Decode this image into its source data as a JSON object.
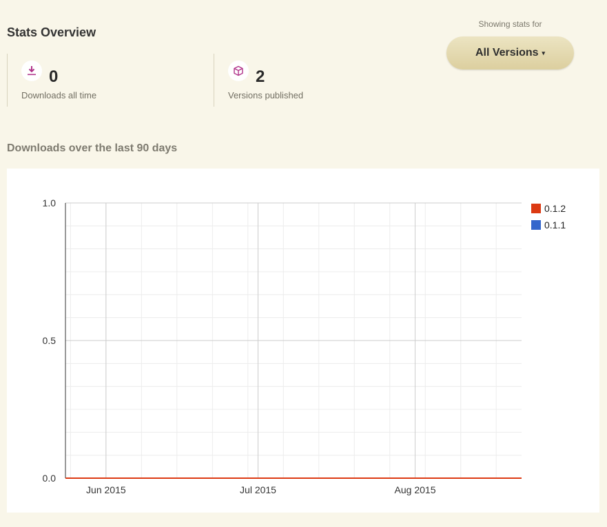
{
  "overview": {
    "title": "Stats Overview",
    "downloads": {
      "value": "0",
      "label": "Downloads all time",
      "icon": "download-icon"
    },
    "versions": {
      "value": "2",
      "label": "Versions published",
      "icon": "package-icon"
    }
  },
  "version_selector": {
    "label": "Showing stats for",
    "selected": "All Versions",
    "caret": "▾"
  },
  "chart_heading": "Downloads over the last 90 days",
  "colors": {
    "accent_icon": "#b0338a",
    "series_012": "#dc3912",
    "series_011": "#3366cc"
  },
  "chart_data": {
    "type": "line",
    "x_start": "2015-05-24",
    "x_end": "2015-08-22",
    "x_ticks": [
      {
        "date": "2015-06-01",
        "label": "Jun 2015"
      },
      {
        "date": "2015-07-01",
        "label": "Jul 2015"
      },
      {
        "date": "2015-08-01",
        "label": "Aug 2015"
      }
    ],
    "y_ticks": [
      {
        "value": 0,
        "label": "0.0"
      },
      {
        "value": 0.5,
        "label": "0.5"
      },
      {
        "value": 1,
        "label": "1.0"
      }
    ],
    "ylim": [
      0,
      1
    ],
    "grid": true,
    "legend_position": "right",
    "series": [
      {
        "name": "0.1.2",
        "color": "#dc3912",
        "x": [
          "2015-05-24",
          "2015-08-22"
        ],
        "values": [
          0,
          0
        ]
      },
      {
        "name": "0.1.1",
        "color": "#3366cc",
        "x": [
          "2015-05-24",
          "2015-08-22"
        ],
        "values": [
          0,
          0
        ]
      }
    ]
  }
}
